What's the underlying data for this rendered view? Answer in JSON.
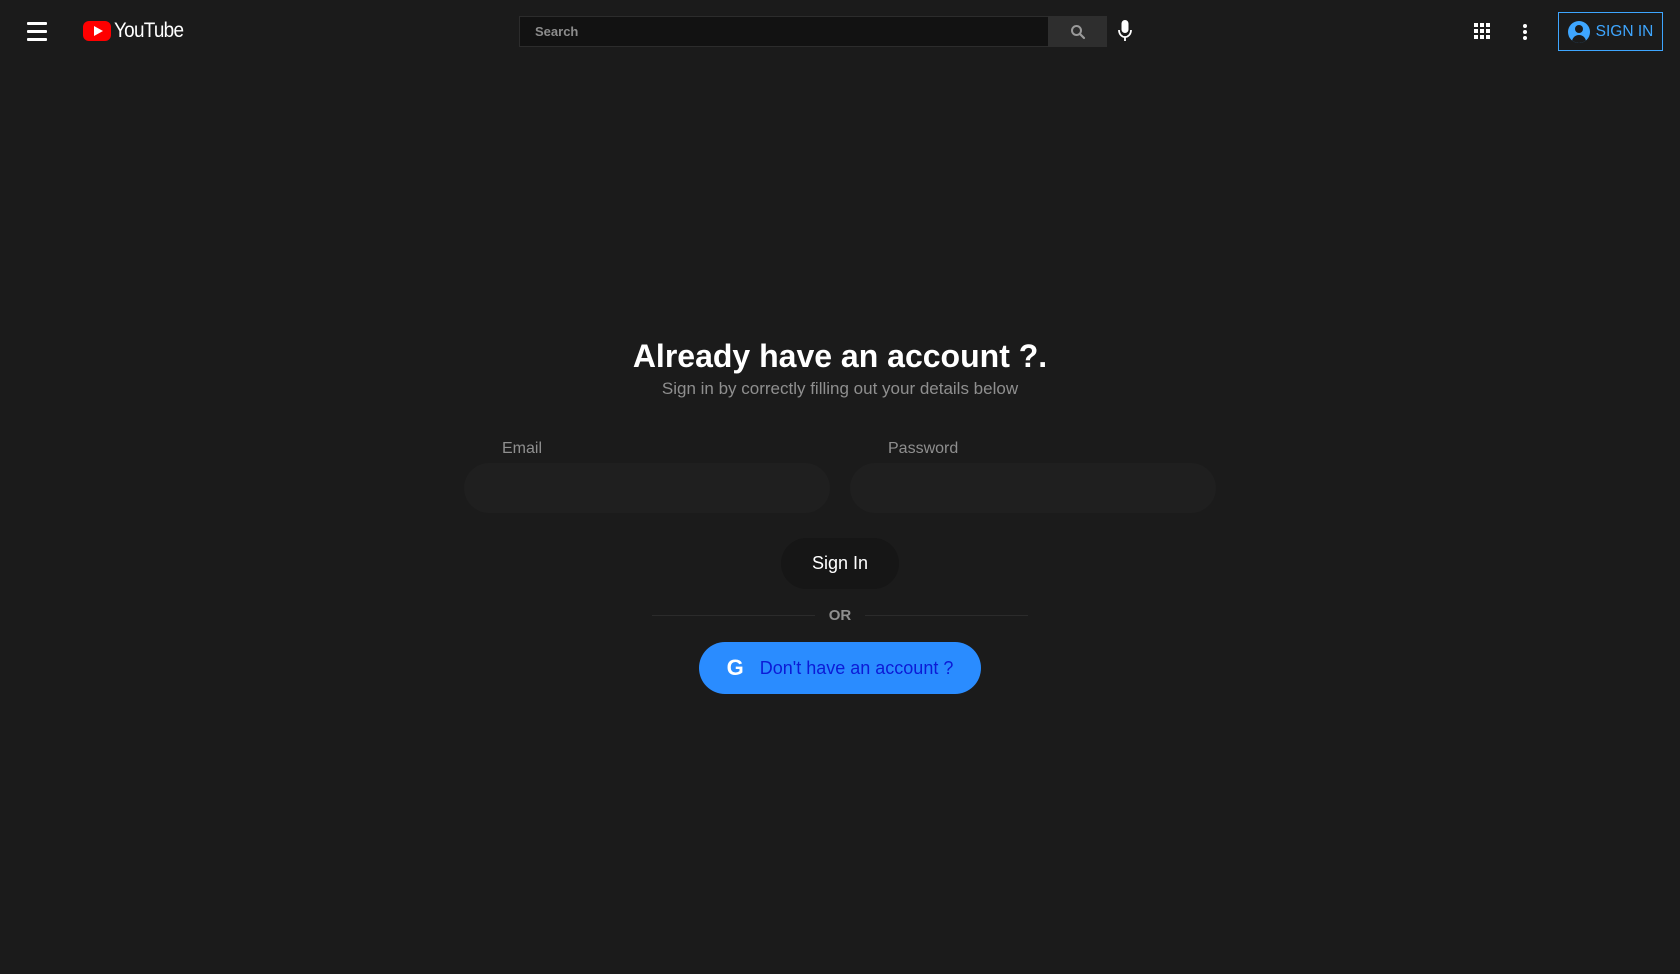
{
  "header": {
    "brand": "YouTube",
    "search_placeholder": "Search",
    "sign_in_label": "SIGN IN"
  },
  "main": {
    "headline": "Already have an account ?.",
    "subline": "Sign in by correctly filling out your details below",
    "email_label": "Email",
    "email_value": "",
    "password_label": "Password",
    "password_value": "",
    "sign_in_button": "Sign In",
    "divider_text": "OR",
    "google_button": "Don't have an account ?",
    "google_icon_glyph": "G"
  },
  "colors": {
    "background": "#1b1b1b",
    "accent_blue": "#3ea6ff",
    "google_button_bg": "#2a8cff",
    "google_button_text": "#0c1bd6",
    "brand_red": "#ff0000"
  },
  "icons": {
    "menu": "hamburger-menu-icon",
    "logo": "youtube-logo-icon",
    "search": "search-icon",
    "mic": "microphone-icon",
    "apps": "apps-grid-icon",
    "more": "more-vertical-icon",
    "account": "account-circle-icon",
    "google": "google-icon"
  }
}
